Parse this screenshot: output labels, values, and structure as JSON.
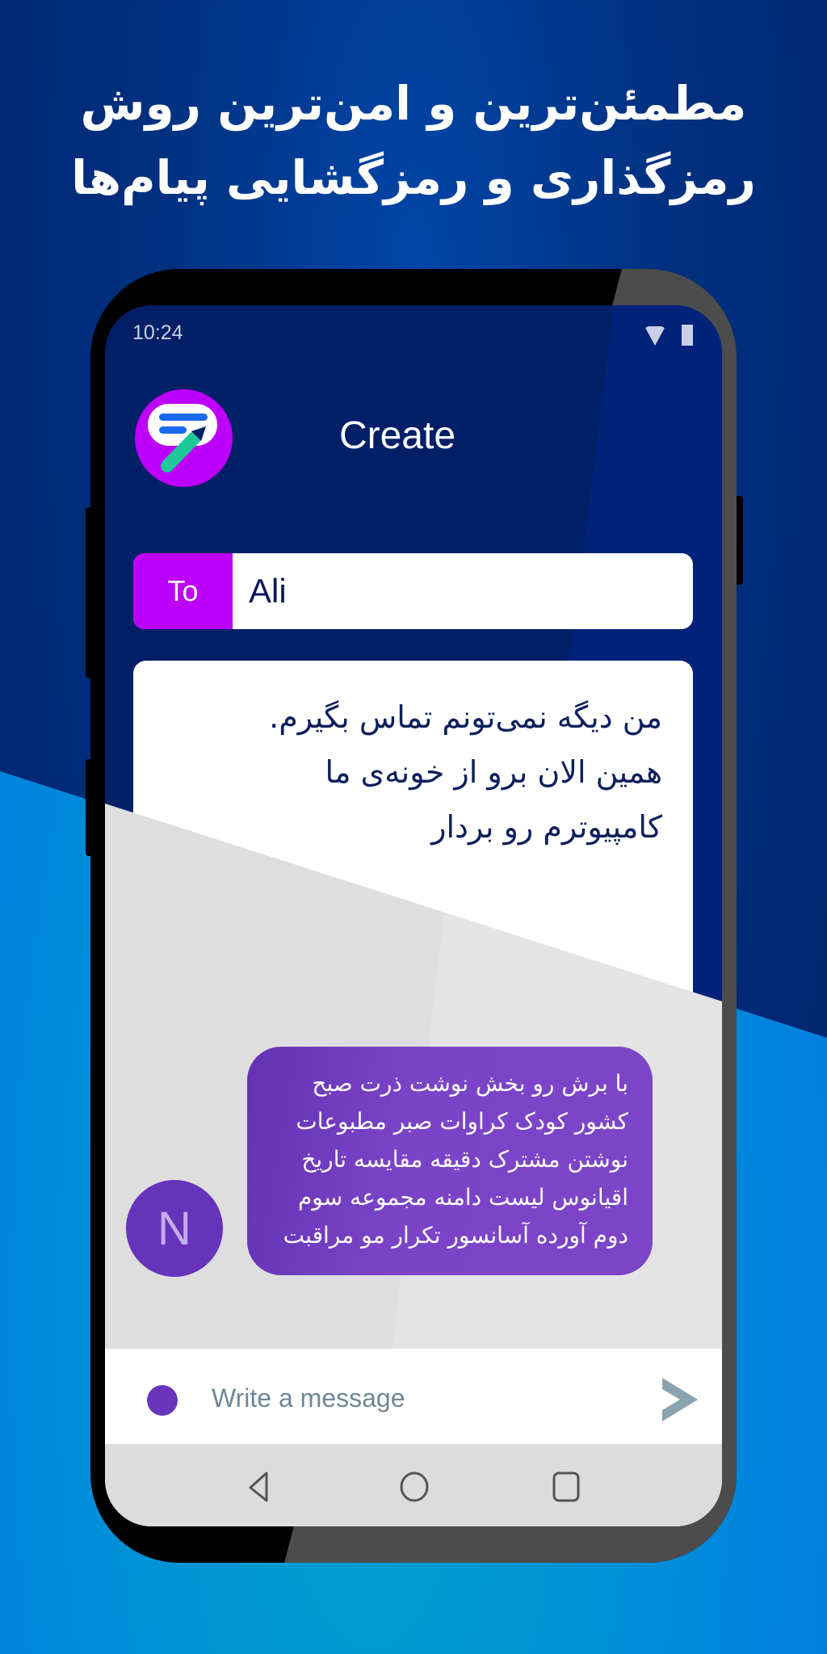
{
  "headline": {
    "line1": "مطمئن‌ترین و امن‌ترین روش",
    "line2": "رمزگذاری و رمزگشایی پیام‌ها"
  },
  "status_bar": {
    "time": "10:24",
    "icons": [
      "wifi-icon",
      "battery-icon"
    ]
  },
  "app_bar": {
    "logo": "chat-pencil-logo",
    "title": "Create"
  },
  "recipient": {
    "label": "To",
    "value": "Ali"
  },
  "message_body": {
    "lines": [
      "من دیگه نمی‌تونم تماس بگیرم.",
      "همین الان برو از خونه‌ی ما",
      "کامپیوترم رو بردار"
    ]
  },
  "received_message": {
    "avatar_initial": "N",
    "lines": [
      "با برش رو بخش نوشت ذرت صبح",
      "کشور کودک کراوات صبر مطبوعات",
      "نوشتن مشترک دقیقه مقایسه تاریخ",
      "اقیانوس لیست دامنه مجموعه سوم",
      "دوم آورده آسانسور تکرار مو مراقبت"
    ]
  },
  "composer": {
    "placeholder": "Write a message",
    "value": "",
    "send_icon": "send-icon"
  },
  "nav_bar": {
    "buttons": [
      "back",
      "home",
      "recents"
    ]
  },
  "colors": {
    "accent_magenta": "#bd00fa",
    "bubble_purple": "#7b44c8",
    "avatar_purple": "#6633bb",
    "screen_navy": "#001f66",
    "logo_teal": "#1fc89a",
    "logo_blue": "#1a6af0"
  }
}
